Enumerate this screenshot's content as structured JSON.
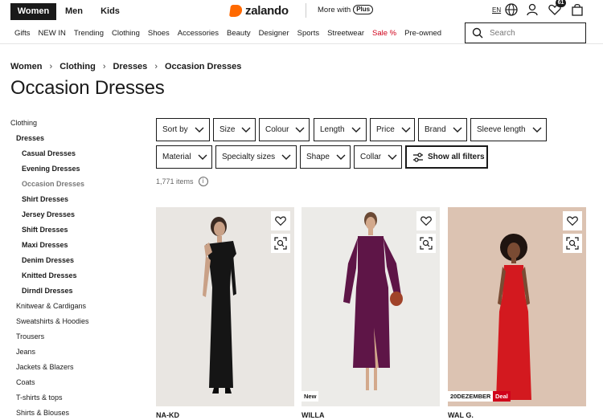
{
  "header": {
    "gender_tabs": [
      "Women",
      "Men",
      "Kids"
    ],
    "logo_text": "zalando",
    "more_with": "More with",
    "plus_label": "Plus",
    "language": "EN",
    "wishlist_count": "61",
    "icons": [
      "globe-icon",
      "account-icon",
      "heart-icon",
      "bag-icon"
    ]
  },
  "nav": {
    "categories": [
      "Gifts",
      "NEW IN",
      "Trending",
      "Clothing",
      "Shoes",
      "Accessories",
      "Beauty",
      "Designer",
      "Sports",
      "Streetwear",
      "Sale %",
      "Pre-owned"
    ],
    "sale_color": "#d0021b"
  },
  "search": {
    "placeholder": "Search"
  },
  "breadcrumb": [
    "Women",
    "Clothing",
    "Dresses",
    "Occasion Dresses"
  ],
  "page_title": "Occasion Dresses",
  "sidebar": {
    "items": [
      "Clothing",
      "Dresses",
      "Casual Dresses",
      "Evening Dresses",
      "Occasion Dresses",
      "Shirt Dresses",
      "Jersey Dresses",
      "Shift Dresses",
      "Maxi Dresses",
      "Denim Dresses",
      "Knitted Dresses",
      "Dirndl Dresses",
      "Knitwear & Cardigans",
      "Sweatshirts & Hoodies",
      "Trousers",
      "Jeans",
      "Jackets & Blazers",
      "Coats",
      "T-shirts & tops",
      "Shirts & Blouses"
    ]
  },
  "filters": {
    "row1": [
      "Sort by",
      "Size",
      "Colour",
      "Length",
      "Price",
      "Brand",
      "Sleeve length"
    ],
    "row2": [
      "Material",
      "Specialty sizes",
      "Shape",
      "Collar"
    ],
    "show_all": "Show all filters"
  },
  "item_count": "1,771 items",
  "products": [
    {
      "brand": "NA-KD",
      "tags": [],
      "dress_color": "#151515",
      "bg": "#e9e6e2"
    },
    {
      "brand": "WILLA",
      "tags": [
        "New"
      ],
      "dress_color": "#5e1547",
      "bg": "#ecebe8"
    },
    {
      "brand": "WAL G.",
      "tags": [
        "20DEZEMBER",
        "Deal"
      ],
      "dress_color": "#d3191f",
      "bg": "#dcc3b2"
    }
  ]
}
